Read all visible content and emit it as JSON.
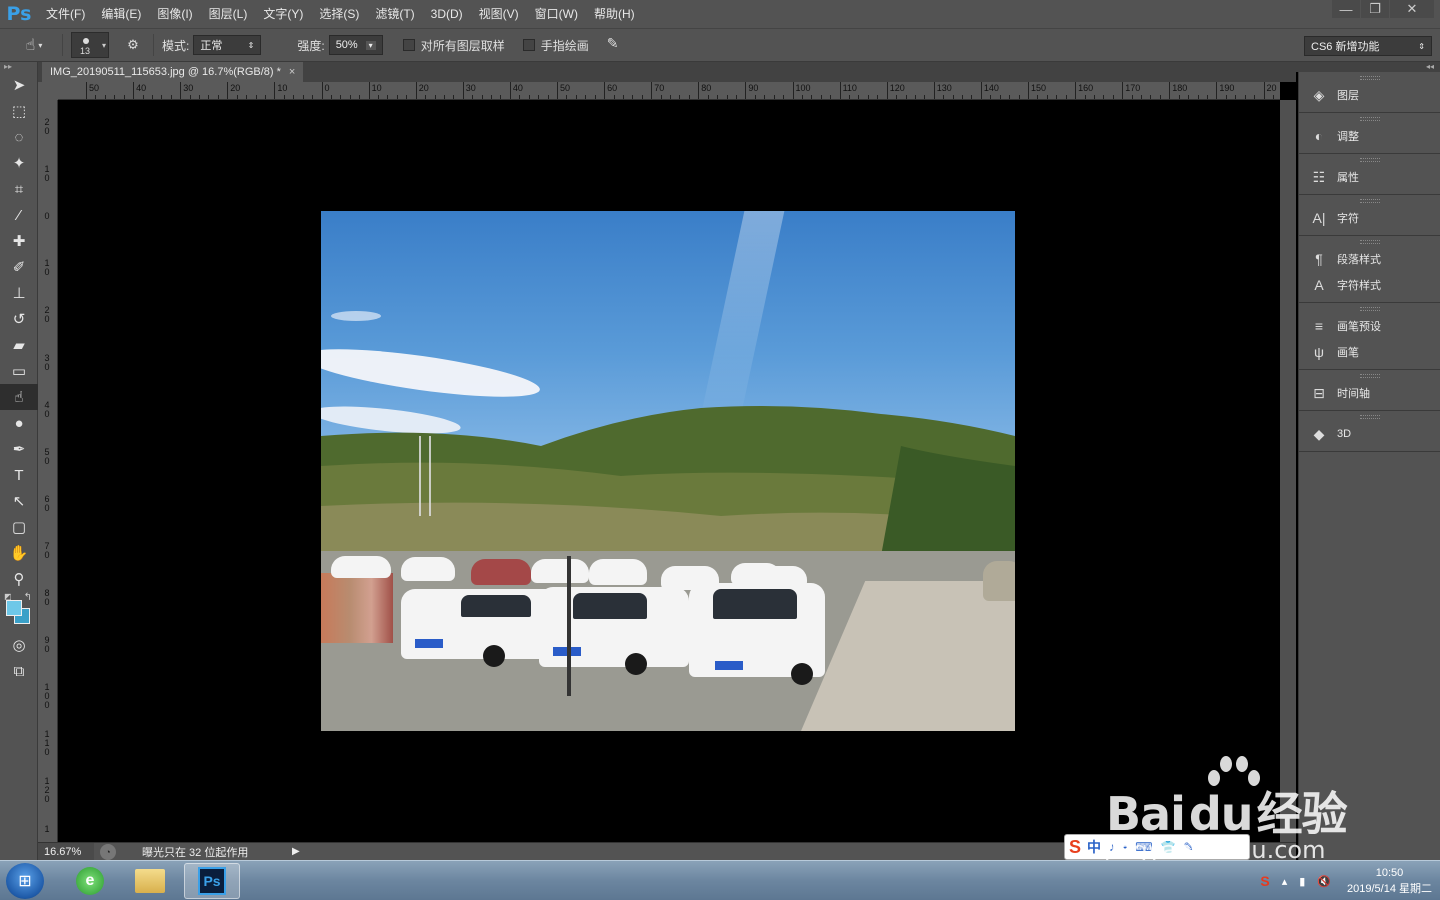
{
  "app": {
    "logo": "Ps",
    "window_controls": {
      "minimize": "—",
      "restore": "❐",
      "close": "✕"
    }
  },
  "menu": [
    "文件(F)",
    "编辑(E)",
    "图像(I)",
    "图层(L)",
    "文字(Y)",
    "选择(S)",
    "滤镜(T)",
    "3D(D)",
    "视图(V)",
    "窗口(W)",
    "帮助(H)"
  ],
  "options": {
    "brush_size": "13",
    "mode_label": "模式:",
    "mode_value": "正常",
    "strength_label": "强度:",
    "strength_value": "50%",
    "sample_all_label": "对所有图层取样",
    "finger_paint_label": "手指绘画",
    "workspace_value": "CS6 新增功能"
  },
  "document": {
    "tab_title": "IMG_20190511_115653.jpg @ 16.7%(RGB/8) *",
    "tab_close": "×",
    "ruler_h_labels": [
      "50",
      "40",
      "30",
      "20",
      "10",
      "0",
      "10",
      "20",
      "30",
      "40",
      "50",
      "60",
      "70",
      "80",
      "90",
      "100",
      "110",
      "120",
      "130",
      "140",
      "150",
      "160",
      "170",
      "180",
      "190",
      "20"
    ],
    "ruler_v_labels": [
      "20",
      "10",
      "0",
      "10",
      "20",
      "30",
      "40",
      "50",
      "60",
      "70",
      "80",
      "90",
      "100",
      "110",
      "120",
      "1"
    ]
  },
  "status": {
    "zoom": "16.67%",
    "message": "曝光只在 32 位起作用",
    "arrow": "▶"
  },
  "panels": [
    {
      "label": "图层",
      "icon": "layers-icon"
    },
    {
      "label": "调整",
      "icon": "adjustments-icon"
    },
    {
      "label": "属性",
      "icon": "properties-icon"
    },
    {
      "label": "字符",
      "icon": "character-icon"
    },
    {
      "label": "段落样式",
      "icon": "paragraph-styles-icon"
    },
    {
      "label": "字符样式",
      "icon": "character-styles-icon"
    },
    {
      "label": "画笔预设",
      "icon": "brush-presets-icon"
    },
    {
      "label": "画笔",
      "icon": "brush-icon"
    },
    {
      "label": "时间轴",
      "icon": "timeline-icon"
    },
    {
      "label": "3D",
      "icon": "3d-icon"
    }
  ],
  "colors": {
    "foreground": "#6ec8e8",
    "background": "#3aa0c8",
    "accent": "#3aa0e8"
  },
  "taskbar": {
    "time": "10:50",
    "date": "2019/5/14 星期二"
  },
  "watermark": {
    "main": "Bai",
    "du": "du",
    "cn": "经验",
    "sub": "jingyan.baidu.com"
  },
  "ime": {
    "zh": "中"
  }
}
